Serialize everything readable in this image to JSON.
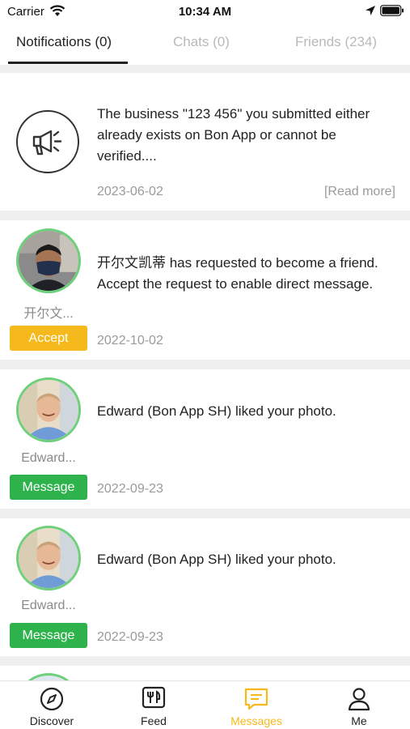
{
  "status_bar": {
    "carrier": "Carrier",
    "time": "10:34 AM"
  },
  "tabs": [
    {
      "label": "Notifications (0)",
      "active": true
    },
    {
      "label": "Chats (0)",
      "active": false
    },
    {
      "label": "Friends (234)",
      "active": false
    }
  ],
  "notifications": [
    {
      "type": "system",
      "icon": "megaphone-icon",
      "text": "The business \"123 456\" you submitted either already exists on Bon App or cannot be verified....",
      "date": "2023-06-02",
      "read_more": "[Read more]"
    },
    {
      "type": "friend_request",
      "name": "开尔文...",
      "text": "开尔文凯蒂 has requested to become a friend. Accept the request to enable direct message.",
      "button": "Accept",
      "date": "2022-10-02"
    },
    {
      "type": "like",
      "name": "Edward...",
      "text": "Edward (Bon App SH) liked your photo.",
      "button": "Message",
      "date": "2022-09-23"
    },
    {
      "type": "like",
      "name": "Edward...",
      "text": "Edward (Bon App SH) liked your photo.",
      "button": "Message",
      "date": "2022-09-23"
    }
  ],
  "tabbar": [
    {
      "label": "Discover",
      "icon": "compass-icon"
    },
    {
      "label": "Feed",
      "icon": "fork-knife-icon"
    },
    {
      "label": "Messages",
      "icon": "message-icon",
      "active": true
    },
    {
      "label": "Me",
      "icon": "person-icon"
    }
  ],
  "colors": {
    "accent": "#f6b91b",
    "message_button": "#2eb24b",
    "avatar_ring": "#6ed07a"
  }
}
